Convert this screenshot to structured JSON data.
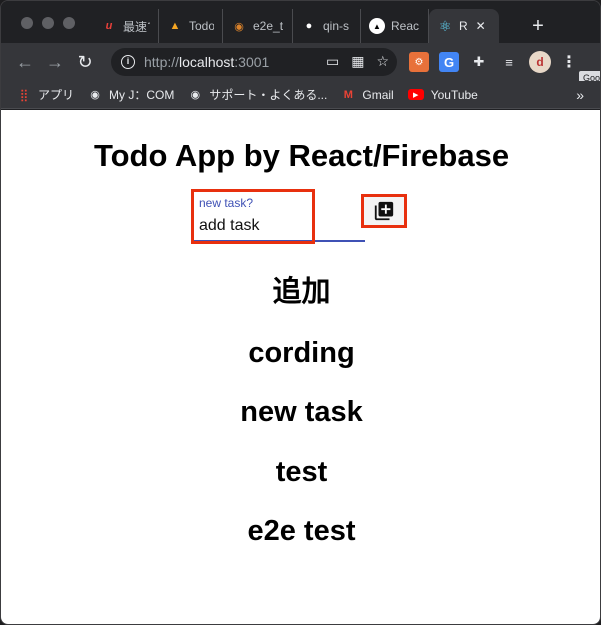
{
  "browser": {
    "tabs": [
      {
        "label": "最速で",
        "icon": "u-icon",
        "glyph": "u",
        "color": "#e8403a"
      },
      {
        "label": "Todo",
        "icon": "firebase-icon",
        "glyph": "▲",
        "color": "#f5a623"
      },
      {
        "label": "e2e_t",
        "icon": "tab-site-icon",
        "glyph": "◉",
        "color": "#d9822b"
      },
      {
        "label": "qin-s",
        "icon": "github-icon",
        "glyph": "●",
        "color": "#ffffff"
      },
      {
        "label": "Reac",
        "icon": "next-icon",
        "glyph": "▲",
        "color": "#000000"
      },
      {
        "label": "R",
        "icon": "react-icon",
        "glyph": "⚛",
        "color": "#61dafb"
      }
    ],
    "new_tab": "+",
    "url_scheme": "http://",
    "url_host": "localhost",
    "url_rest": ":3001",
    "tooltip": "Goo",
    "bookmarks": [
      {
        "label": "アプリ",
        "icon": "apps-grid-icon"
      },
      {
        "label": "My J：COM",
        "icon": "globe-icon"
      },
      {
        "label": "サポート・よくある...",
        "icon": "globe-icon"
      },
      {
        "label": "Gmail",
        "icon": "gmail-icon"
      },
      {
        "label": "YouTube",
        "icon": "youtube-icon"
      }
    ],
    "bookmarks_more": "»"
  },
  "app": {
    "title": "Todo App by React/Firebase",
    "input_label": "new task?",
    "input_value": "add task",
    "tasks": [
      "追加",
      "cording",
      "new task",
      "test",
      "e2e test"
    ]
  }
}
